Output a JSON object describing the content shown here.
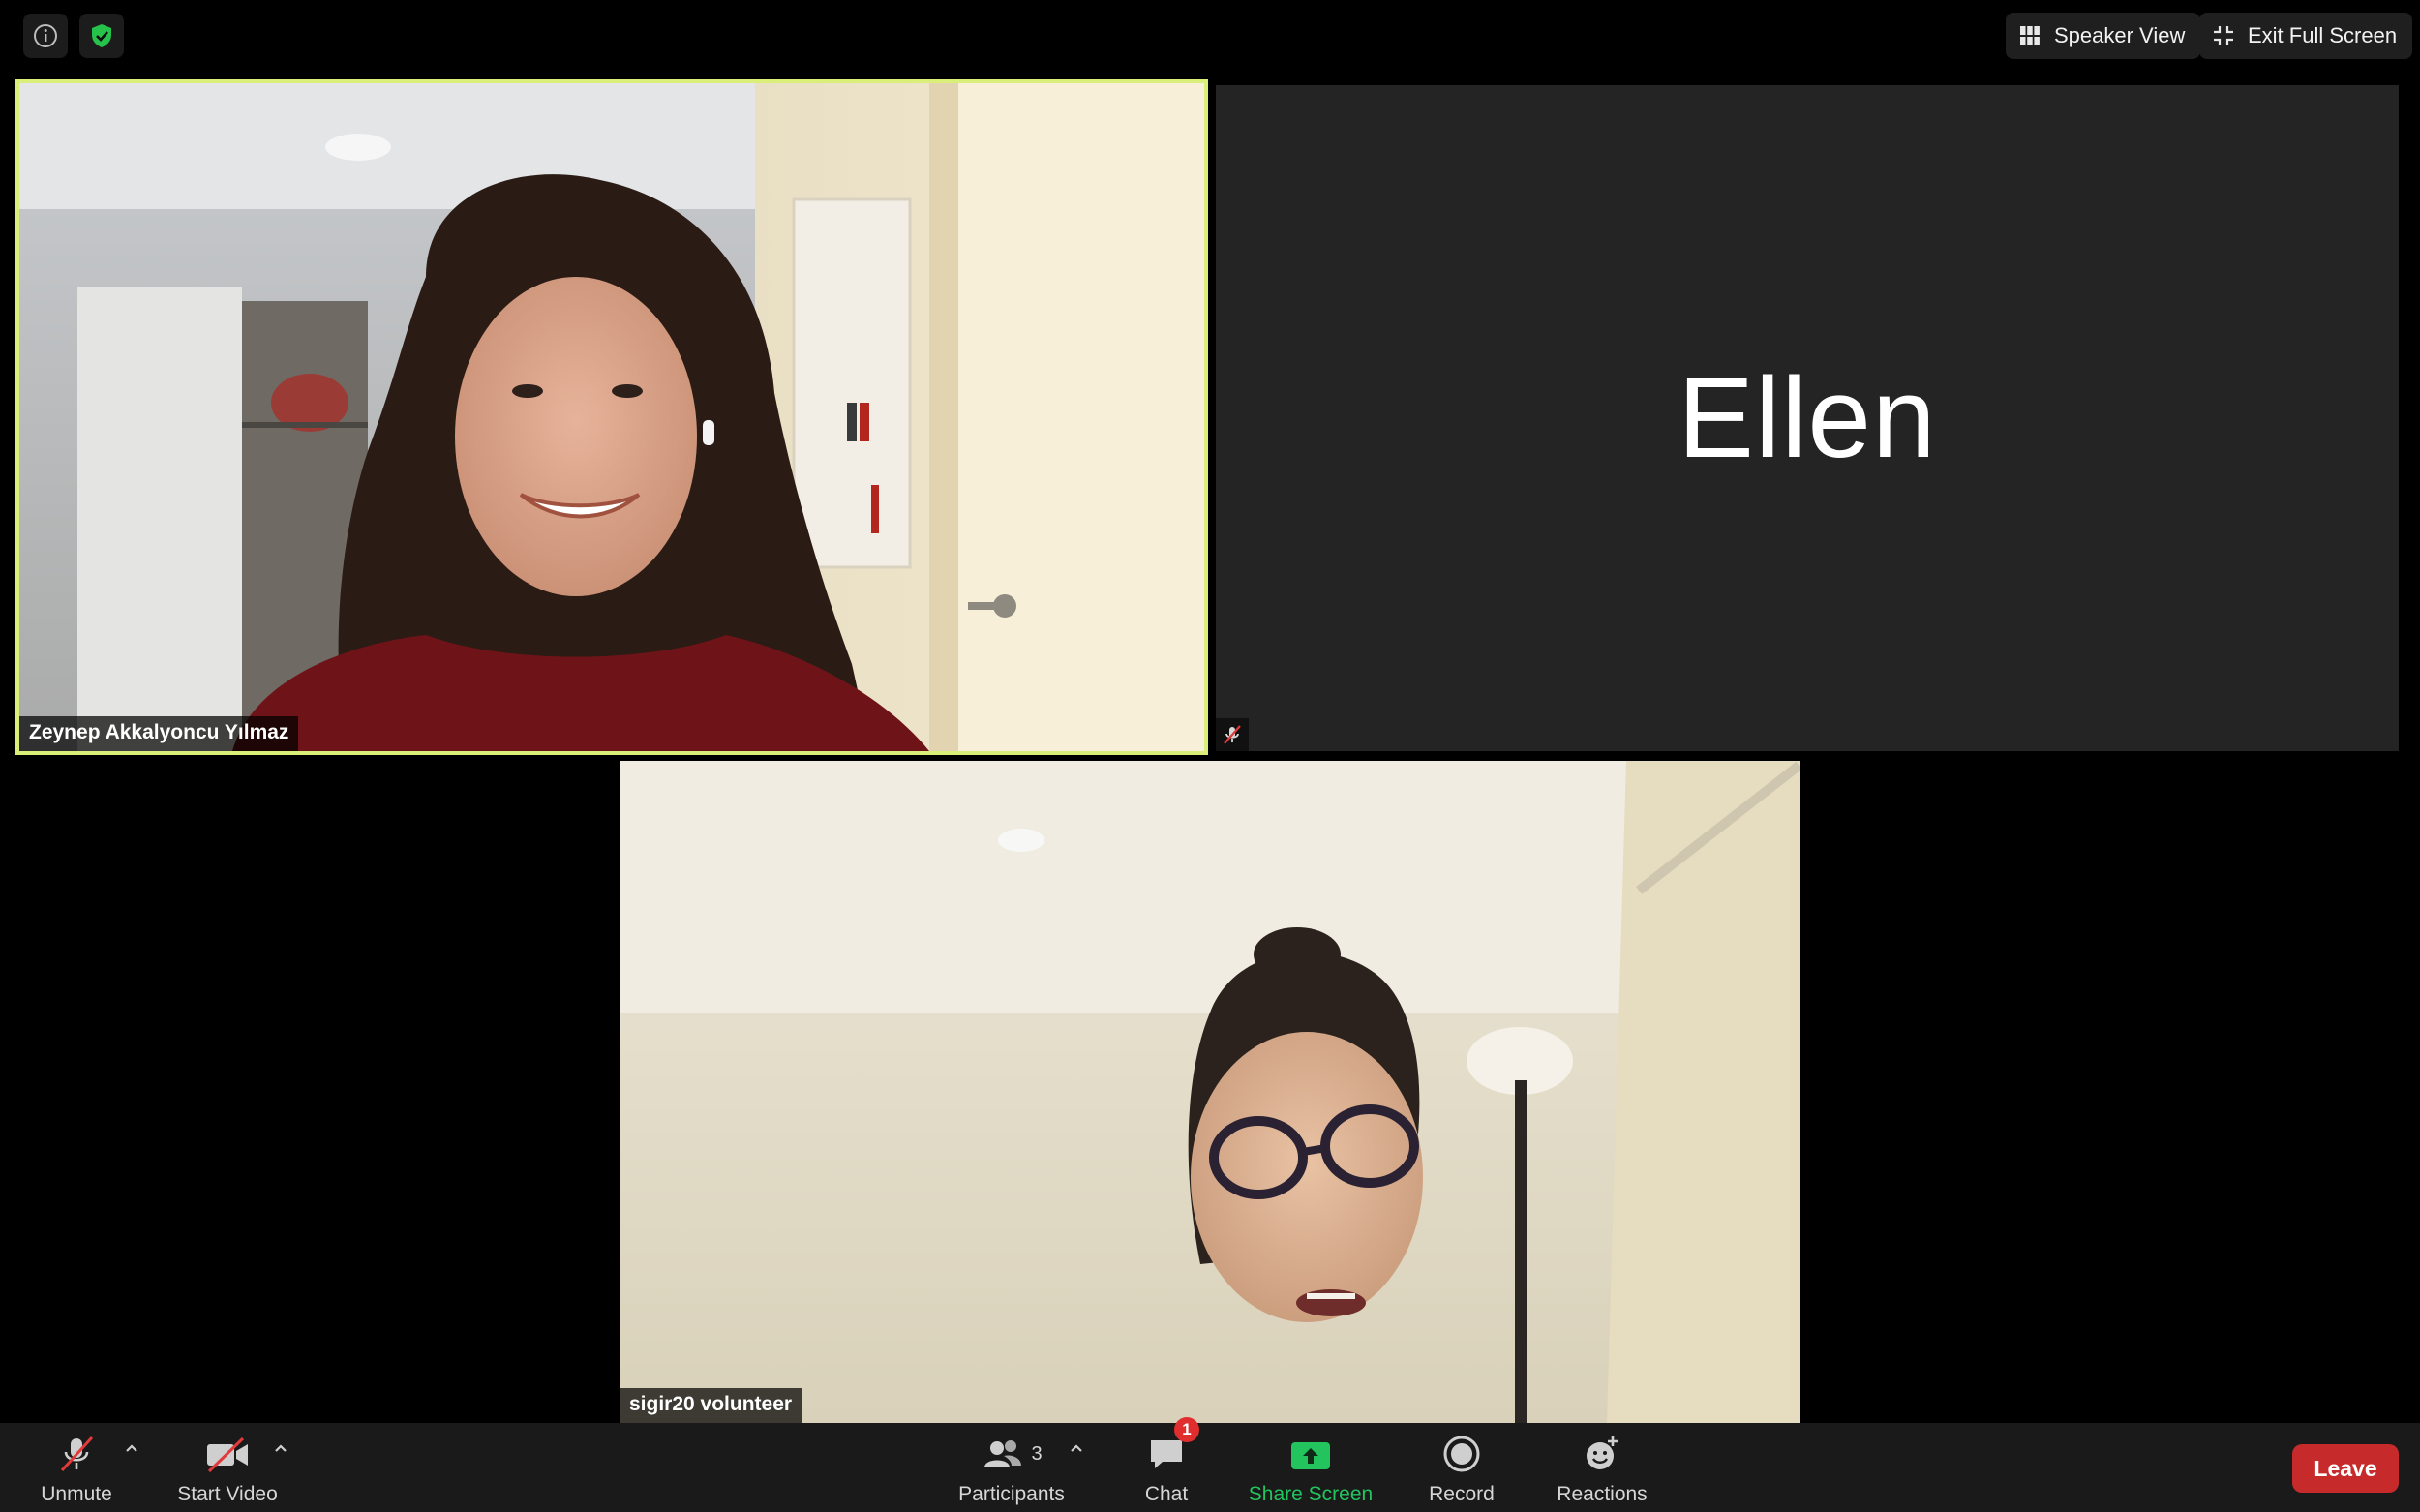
{
  "top_bar": {
    "info_icon": "info-icon",
    "security_icon": "shield-check-icon",
    "speaker_view_label": "Speaker View",
    "exit_fullscreen_label": "Exit Full Screen"
  },
  "participants": [
    {
      "name": "Zeynep Akkalyoncu Yılmaz",
      "video": "on",
      "active_speaker": true
    },
    {
      "name": "Ellen",
      "video": "off",
      "muted": true
    },
    {
      "name": "sigir20 volunteer",
      "video": "on"
    }
  ],
  "toolbar": {
    "unmute_label": "Unmute",
    "start_video_label": "Start Video",
    "participants_label": "Participants",
    "participants_count": "3",
    "chat_label": "Chat",
    "chat_badge": "1",
    "share_screen_label": "Share Screen",
    "record_label": "Record",
    "reactions_label": "Reactions",
    "leave_label": "Leave"
  },
  "colors": {
    "active_border": "#d9ef7a",
    "share_green": "#23c45e",
    "leave_red": "#c72a2a",
    "badge_red": "#e02d2d"
  }
}
